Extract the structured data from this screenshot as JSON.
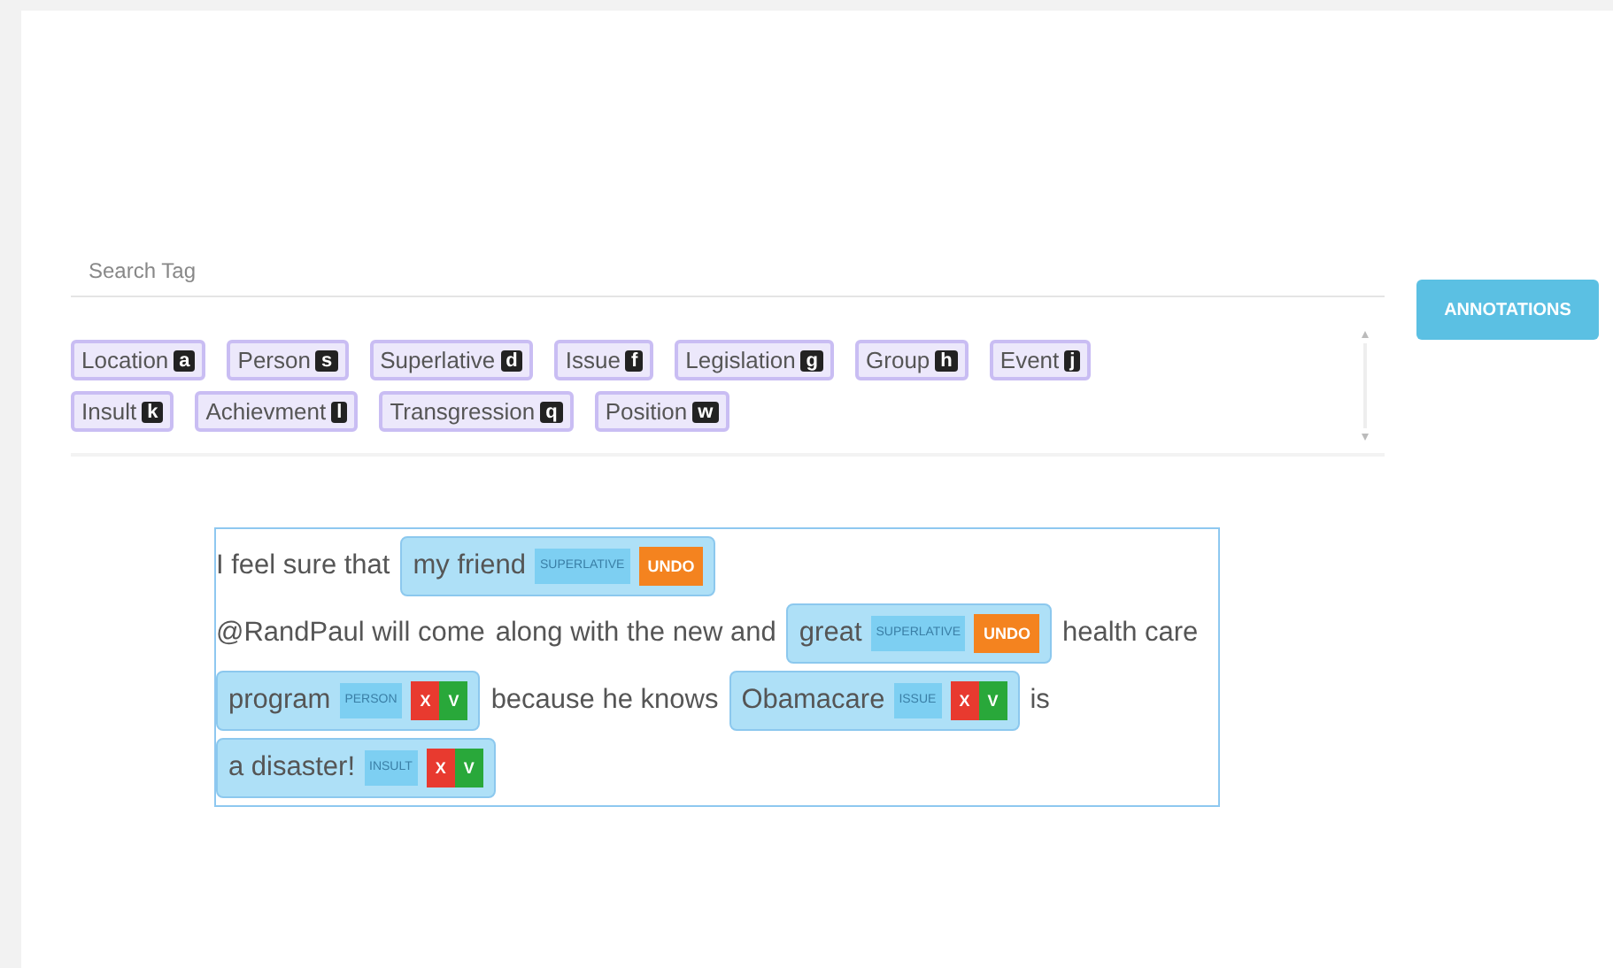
{
  "search": {
    "placeholder": "Search Tag"
  },
  "annotations_button": "ANNOTATIONS",
  "tags": [
    {
      "label": "Location",
      "key": "a"
    },
    {
      "label": "Person",
      "key": "s"
    },
    {
      "label": "Superlative",
      "key": "d"
    },
    {
      "label": "Issue",
      "key": "f"
    },
    {
      "label": "Legislation",
      "key": "g"
    },
    {
      "label": "Group",
      "key": "h"
    },
    {
      "label": "Event",
      "key": "j"
    },
    {
      "label": "Insult",
      "key": "k"
    },
    {
      "label": "Achievment",
      "key": "l"
    },
    {
      "label": "Transgression",
      "key": "q"
    },
    {
      "label": "Position",
      "key": "w"
    }
  ],
  "document": [
    {
      "kind": "text",
      "text": "I feel sure that"
    },
    {
      "kind": "annotation",
      "text": "my friend",
      "tag": "SUPERLATIVE",
      "actions": [
        {
          "kind": "undo",
          "label": "UNDO"
        }
      ]
    },
    {
      "kind": "text",
      "text": "@RandPaul will come"
    },
    {
      "kind": "text",
      "text": "along with the new and"
    },
    {
      "kind": "annotation",
      "text": "great",
      "tag": "SUPERLATIVE",
      "actions": [
        {
          "kind": "undo",
          "label": "UNDO"
        }
      ]
    },
    {
      "kind": "text",
      "text": "health care"
    },
    {
      "kind": "annotation",
      "text": "program",
      "tag": "PERSON",
      "actions": [
        {
          "kind": "reject",
          "label": "X"
        },
        {
          "kind": "accept",
          "label": "V"
        }
      ]
    },
    {
      "kind": "text",
      "text": "because he knows"
    },
    {
      "kind": "annotation",
      "text": "Obamacare",
      "tag": "ISSUE",
      "actions": [
        {
          "kind": "reject",
          "label": "X"
        },
        {
          "kind": "accept",
          "label": "V"
        }
      ]
    },
    {
      "kind": "text",
      "text": "is"
    },
    {
      "kind": "annotation",
      "text": "a disaster!",
      "tag": "INSULT",
      "actions": [
        {
          "kind": "reject",
          "label": "X"
        },
        {
          "kind": "accept",
          "label": "V"
        }
      ]
    }
  ]
}
